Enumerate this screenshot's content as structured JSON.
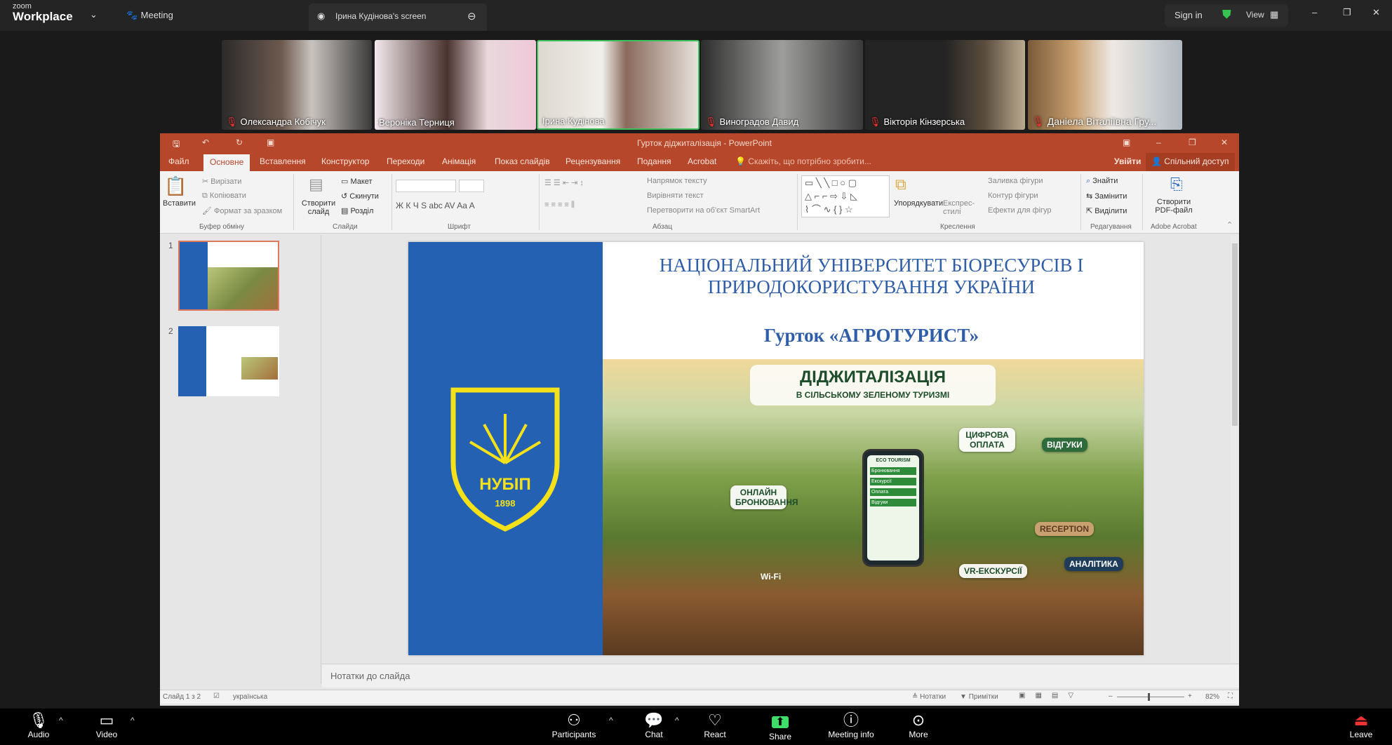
{
  "zoom": {
    "brand_small": "zoom",
    "brand": "Workplace",
    "meeting_label": "Meeting",
    "share_tab": "Ірина Кудінова's screen",
    "sign_in": "Sign in",
    "view": "View",
    "participants": [
      "Олександра Кобічук",
      "Вероніка Терниця",
      "Ірина Кудінова",
      "Виноградов Давид",
      "Вікторія Кінзерська",
      "Даніела Віталіївна Гру..."
    ],
    "toolbar": [
      {
        "label": "Audio",
        "icon": "microphone-icon"
      },
      {
        "label": "Video",
        "icon": "video-camera-icon"
      },
      {
        "label": "Participants",
        "icon": "people-icon"
      },
      {
        "label": "Chat",
        "icon": "chat-icon"
      },
      {
        "label": "React",
        "icon": "heart-icon"
      },
      {
        "label": "Share",
        "icon": "share-arrow-icon"
      },
      {
        "label": "Meeting info",
        "icon": "info-icon"
      },
      {
        "label": "More",
        "icon": "more-icon"
      },
      {
        "label": "Leave",
        "icon": "leave-icon"
      }
    ],
    "colors": {
      "share": "#3fdc6a",
      "active_speaker": "#3fbf5f",
      "shield": "#35c24e"
    }
  },
  "ppt": {
    "title": "Гурток діджиталізація - PowerPoint",
    "tabs": [
      "Файл",
      "Основне",
      "Вставлення",
      "Конструктор",
      "Переходи",
      "Анімація",
      "Показ слайдів",
      "Рецензування",
      "Подання",
      "Acrobat"
    ],
    "tell_me": "Скажіть, що потрібно зробити...",
    "sign_in": "Увійти",
    "share": "Спільний доступ",
    "ribbon": {
      "paste": "Вставити",
      "cut": "Вирізати",
      "copy": "Копіювати",
      "format_painter": "Формат за зразком",
      "clipboard": "Буфер обміну",
      "new_slide": "Створити слайд",
      "layout": "Макет",
      "reset": "Скинути",
      "section": "Розділ",
      "slides": "Слайди",
      "font": "Шрифт",
      "text_direction": "Напрямок тексту",
      "align_text": "Вирівняти текст",
      "smartart": "Перетворити на об'єкт SmartArt",
      "paragraph": "Абзац",
      "arrange": "Упорядкувати",
      "quick_styles": "Експрес-стилі",
      "shape_fill": "Заливка фігури",
      "shape_outline": "Контур фігури",
      "shape_effects": "Ефекти для фігур",
      "drawing": "Креслення",
      "find": "Знайти",
      "replace": "Замінити",
      "select": "Виділити",
      "editing": "Редагування",
      "create_pdf": "Створити PDF-файл",
      "acrobat": "Adobe Acrobat"
    },
    "thumb_numbers": [
      "1",
      "2"
    ],
    "slide": {
      "university": "НАЦІОНАЛЬНИЙ УНІВЕРСИТЕТ БІОРЕСУРСІВ І ПРИРОДОКОРИСТУВАННЯ УКРАЇНИ",
      "club": "Гурток «АГРОТУРИСТ»",
      "logo_text": "НУБІП",
      "logo_year": "1898",
      "image_title": "ДІДЖИТАЛІЗАЦІЯ",
      "image_subtitle": "В СІЛЬСЬКОМУ ЗЕЛЕНОМУ ТУРИЗМІ",
      "image_labels": [
        "ОНЛАЙН БРОНЮВАННЯ",
        "ЦИФРОВА ОПЛАТА",
        "ВІДГУКИ",
        "VR-ЕКСКУРСІЇ",
        "АНАЛІТИКА",
        "Wi-Fi",
        "RECEPTION"
      ],
      "phone_title": "ECO TOURISM",
      "phone_items": [
        "Бронювання",
        "Екскурсії",
        "Оплата",
        "Відгуки"
      ],
      "colors": {
        "blue": "#2461b2",
        "yellow": "#f4e11a",
        "title": "#2f5da8"
      }
    },
    "notes": "Нотатки до слайда",
    "status": {
      "slide": "Слайд 1 з 2",
      "language": "українська",
      "notes": "Нотатки",
      "comments": "Примітки",
      "zoom": "82%"
    }
  }
}
